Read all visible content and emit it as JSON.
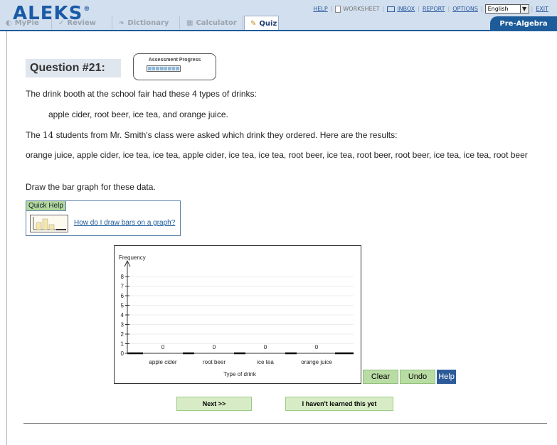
{
  "header": {
    "logo": "ALEKS",
    "logo_mark": "®",
    "links": {
      "help": "HELP",
      "worksheet": "WORKSHEET",
      "inbox": "INBOX",
      "report": "REPORT",
      "options": "OPTIONS",
      "language": "English",
      "exit": "EXIT"
    }
  },
  "tabs": [
    {
      "label": "MyPie",
      "icon": "pie-icon"
    },
    {
      "label": "Review",
      "icon": "check-icon"
    },
    {
      "label": "Dictionary",
      "icon": "book-icon"
    },
    {
      "label": "Calculator",
      "icon": "calculator-icon"
    },
    {
      "label": "Quiz",
      "icon": "quiz-icon"
    }
  ],
  "course": "Pre-Algebra",
  "question": {
    "title": "Question #21:",
    "progress_label": "Assessment Progress",
    "progress_fraction": 1.0
  },
  "problem": {
    "intro": "The drink booth at the school fair had these 4 types of drinks:",
    "drinks": "apple cider, root beer, ice tea, and orange juice.",
    "students_pre": "The ",
    "students_num": "14",
    "students_post": " students from Mr. Smith's class were asked which drink they ordered. Here are the results:",
    "results": "orange juice, apple cider, ice tea, ice tea, apple cider, ice tea, ice tea, root beer, ice tea, root beer, root beer, ice tea, ice tea, root beer",
    "instruction": "Draw the bar graph for these data."
  },
  "quick_help": {
    "title": "Quick Help",
    "link": "How do I draw bars on a graph?"
  },
  "chart_data": {
    "type": "bar",
    "ylabel": "Frequency",
    "xlabel": "Type of drink",
    "categories": [
      "apple cider",
      "root beer",
      "ice tea",
      "orange juice"
    ],
    "values": [
      0,
      0,
      0,
      0
    ],
    "yticks": [
      0,
      1,
      2,
      3,
      4,
      5,
      6,
      7,
      8
    ],
    "ylim": [
      0,
      8
    ]
  },
  "graph_buttons": {
    "clear": "Clear",
    "undo": "Undo",
    "help": "Help"
  },
  "actions": {
    "next": "Next >>",
    "havent_learned": "I haven't learned this yet"
  }
}
